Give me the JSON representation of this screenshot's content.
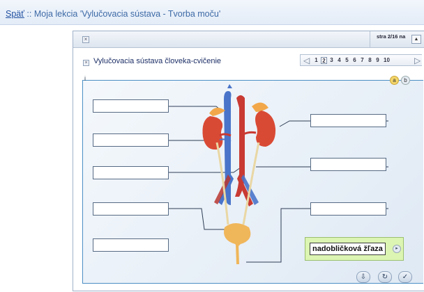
{
  "header": {
    "back_link": "Späť",
    "separator": " :: ",
    "title": "Moja lekcia 'Vylučovacia sústava - Tvorba moču'"
  },
  "window": {
    "close_icon": "close-icon",
    "page_label": "stra 2/16 na",
    "up_icon": "triangle-up-icon"
  },
  "exercise": {
    "title": "Vylučovacia sústava človeka-cvičenie",
    "info_label": "i",
    "pages": [
      "1",
      "2",
      "3",
      "4",
      "5",
      "6",
      "7",
      "8",
      "9",
      "10"
    ],
    "current_page": "2",
    "option_a": "a",
    "option_b": "b"
  },
  "drag_item": {
    "label": "nadobličková žľaza"
  },
  "colors": {
    "link": "#1f4fa0",
    "stage_border": "#4a8ec4",
    "drag_card": "#dcf5b2"
  }
}
